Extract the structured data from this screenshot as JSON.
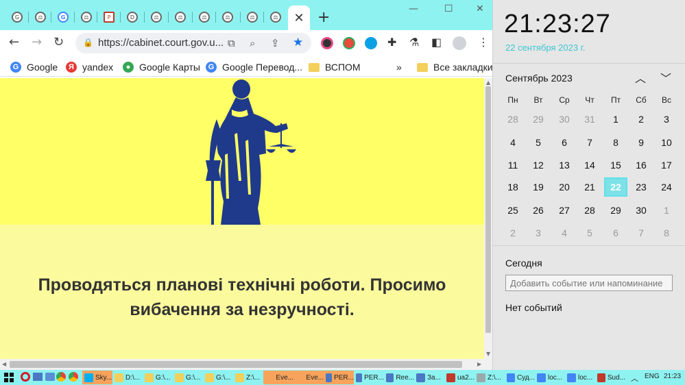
{
  "browser": {
    "tabs": [
      {
        "icon": "court-icon",
        "glyph": "G"
      },
      {
        "icon": "court-icon",
        "glyph": "⚖"
      },
      {
        "icon": "google-icon",
        "glyph": "G"
      },
      {
        "icon": "court-icon",
        "glyph": "⚖"
      },
      {
        "icon": "pma-icon",
        "glyph": "P"
      },
      {
        "icon": "d-icon",
        "glyph": "D"
      },
      {
        "icon": "court-icon",
        "glyph": "⚖"
      },
      {
        "icon": "court-icon",
        "glyph": "⚖"
      },
      {
        "icon": "court-icon",
        "glyph": "⚖"
      },
      {
        "icon": "court-icon",
        "glyph": "⚖"
      },
      {
        "icon": "court-icon",
        "glyph": "⚖"
      },
      {
        "icon": "court-icon",
        "glyph": "⚖"
      }
    ],
    "active_tab_close": "✕",
    "new_tab": "+",
    "url": "https://cabinet.court.gov.u...",
    "bookmarks": [
      {
        "label": "Google",
        "color": "#4285f4",
        "glyph": "G"
      },
      {
        "label": "yandex",
        "color": "#e53935",
        "glyph": "Я"
      },
      {
        "label": "Google Карты",
        "color": "#34a853",
        "glyph": "●"
      },
      {
        "label": "Google Перевод...",
        "color": "#4285f4",
        "glyph": "G"
      },
      {
        "label": "ВСПОМ",
        "folder": true
      },
      {
        "label": "»"
      },
      {
        "label": "Все закладки",
        "folder": true
      }
    ]
  },
  "page": {
    "message_line1": "Проводяться планові технічні роботи. Просимо",
    "message_line2": "вибачення за незручності."
  },
  "calendar": {
    "time": "21:23:27",
    "date": "22 сентября 2023 г.",
    "month": "Сентябрь 2023",
    "weekdays": [
      "Пн",
      "Вт",
      "Ср",
      "Чт",
      "Пт",
      "Сб",
      "Вс"
    ],
    "weeks": [
      [
        "28",
        "29",
        "30",
        "31",
        "1",
        "2",
        "3"
      ],
      [
        "4",
        "5",
        "6",
        "7",
        "8",
        "9",
        "10"
      ],
      [
        "11",
        "12",
        "13",
        "14",
        "15",
        "16",
        "17"
      ],
      [
        "18",
        "19",
        "20",
        "21",
        "22",
        "23",
        "24"
      ],
      [
        "25",
        "26",
        "27",
        "28",
        "29",
        "30",
        "1"
      ],
      [
        "2",
        "3",
        "4",
        "5",
        "6",
        "7",
        "8"
      ]
    ],
    "today_value": "22",
    "today_label": "Сегодня",
    "event_placeholder": "Добавить событие или напоминание",
    "no_events": "Нет событий"
  },
  "taskbar": {
    "items": [
      {
        "label": "Sky...",
        "hl": true
      },
      {
        "label": "D:\\..."
      },
      {
        "label": "G:\\..."
      },
      {
        "label": "G:\\..."
      },
      {
        "label": "G:\\..."
      },
      {
        "label": "Z:\\..."
      },
      {
        "label": "Eve...",
        "hl": true
      },
      {
        "label": "Eve...",
        "hl": true
      },
      {
        "label": "PER...",
        "hl": true
      },
      {
        "label": "PER..."
      },
      {
        "label": "Ree..."
      },
      {
        "label": "За..."
      },
      {
        "label": "ua2..."
      },
      {
        "label": "Z:\\..."
      },
      {
        "label": "Суд..."
      },
      {
        "label": "loc..."
      },
      {
        "label": "loc..."
      },
      {
        "label": "Sud..."
      }
    ],
    "lang": "ENG",
    "time": "21:23"
  },
  "colors": {
    "accent": "#8ef2f0",
    "banner": "#ffff66",
    "lower": "#fbfb9e",
    "themis": "#1f3a8a",
    "date_text": "#3dc7d3"
  }
}
